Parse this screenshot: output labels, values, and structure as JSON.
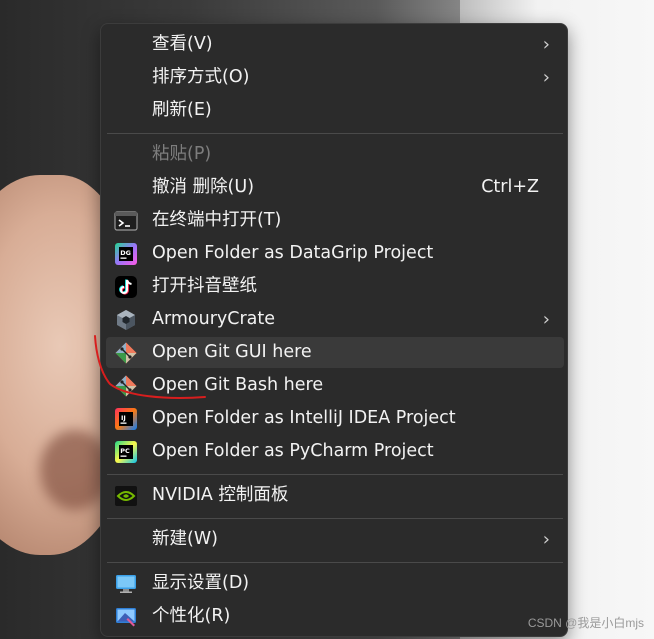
{
  "colors": {
    "menu_bg": "#2b2b2b",
    "hover_bg": "#3a3a3a",
    "text": "#f2f2f2",
    "disabled_text": "#7d7d7d",
    "annotation_red": "#d81e1e"
  },
  "menu": {
    "items": [
      {
        "label": "查看(V)",
        "icon": "",
        "submenu": true
      },
      {
        "label": "排序方式(O)",
        "icon": "",
        "submenu": true
      },
      {
        "label": "刷新(E)",
        "icon": ""
      },
      {
        "label": "粘贴(P)",
        "icon": "",
        "disabled": true
      },
      {
        "label": "撤消 删除(U)",
        "icon": "",
        "shortcut": "Ctrl+Z"
      },
      {
        "label": "在终端中打开(T)",
        "icon": "terminal-icon"
      },
      {
        "label": "Open Folder as DataGrip Project",
        "icon": "datagrip-icon"
      },
      {
        "label": "打开抖音壁纸",
        "icon": "douyin-icon"
      },
      {
        "label": "ArmouryCrate",
        "icon": "armourycrate-icon",
        "submenu": true
      },
      {
        "label": "Open Git GUI here",
        "icon": "git-icon",
        "highlighted": true
      },
      {
        "label": "Open Git Bash here",
        "icon": "git-icon"
      },
      {
        "label": "Open Folder as IntelliJ IDEA Project",
        "icon": "intellij-icon"
      },
      {
        "label": "Open Folder as PyCharm Project",
        "icon": "pycharm-icon"
      },
      {
        "label": "NVIDIA 控制面板",
        "icon": "nvidia-icon"
      },
      {
        "label": "新建(W)",
        "icon": "",
        "submenu": true
      },
      {
        "label": "显示设置(D)",
        "icon": "display-settings-icon"
      },
      {
        "label": "个性化(R)",
        "icon": "personalize-icon"
      }
    ],
    "submenu_arrow": "›"
  },
  "watermark": "CSDN @我是小白mjs"
}
